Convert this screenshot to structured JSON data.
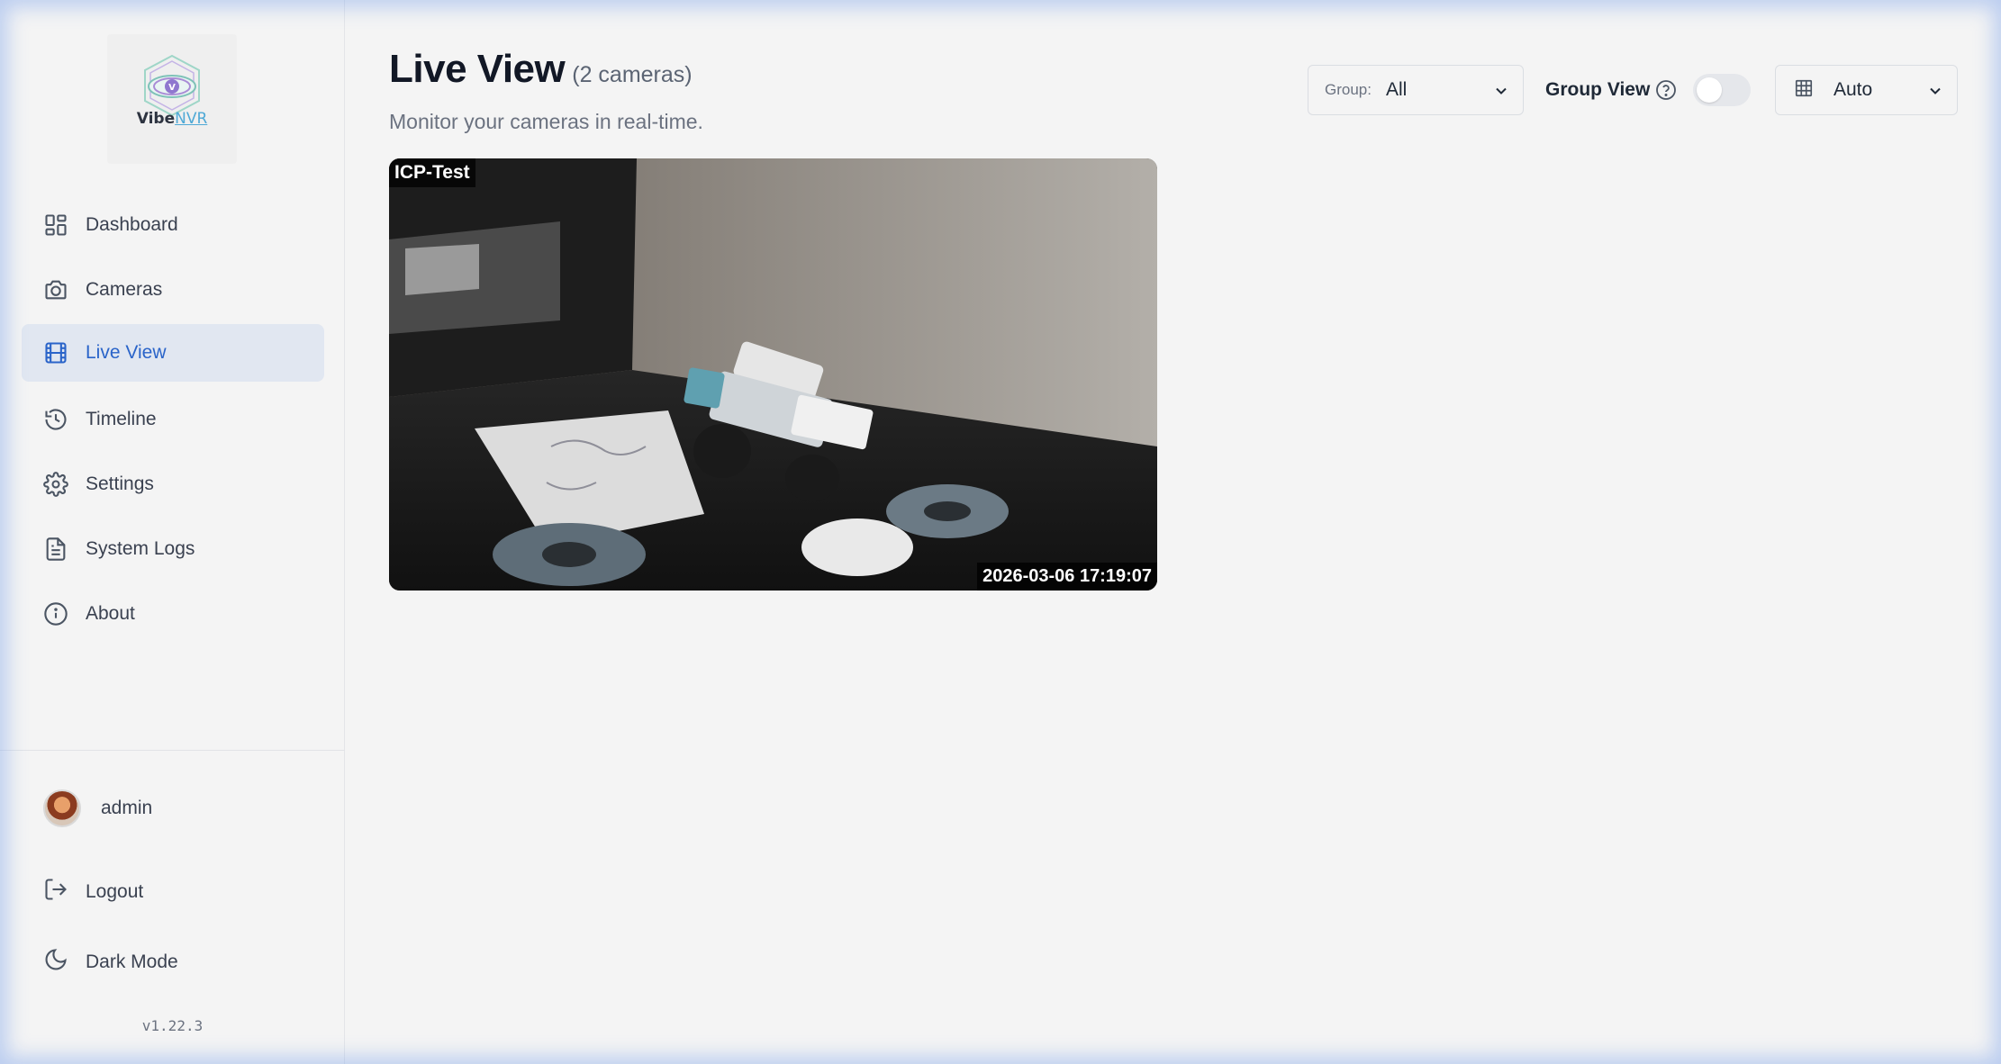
{
  "app": {
    "logo_text_primary": "Vibe",
    "logo_text_secondary": "NVR",
    "version": "v1.22.3"
  },
  "sidebar": {
    "items": [
      {
        "label": "Dashboard",
        "icon": "dashboard-icon",
        "active": false
      },
      {
        "label": "Cameras",
        "icon": "camera-icon",
        "active": false
      },
      {
        "label": "Live View",
        "icon": "film-icon",
        "active": true
      },
      {
        "label": "Timeline",
        "icon": "history-icon",
        "active": false
      },
      {
        "label": "Settings",
        "icon": "gear-icon",
        "active": false
      },
      {
        "label": "System Logs",
        "icon": "document-icon",
        "active": false
      },
      {
        "label": "About",
        "icon": "info-icon",
        "active": false
      }
    ],
    "user": {
      "name": "admin"
    },
    "logout_label": "Logout",
    "dark_mode_label": "Dark Mode"
  },
  "header": {
    "title": "Live View",
    "camera_count": "(2 cameras)",
    "subtitle": "Monitor your cameras in real-time."
  },
  "controls": {
    "group_label": "Group:",
    "group_value": "All",
    "group_view_label": "Group View",
    "group_view_enabled": false,
    "layout_value": "Auto"
  },
  "cameras": [
    {
      "name": "ICP-Test",
      "timestamp": "2026-03-06 17:19:07"
    }
  ],
  "colors": {
    "accent": "#2a64c9",
    "active_bg": "#e1e7f1",
    "background": "#f4f4f4"
  }
}
